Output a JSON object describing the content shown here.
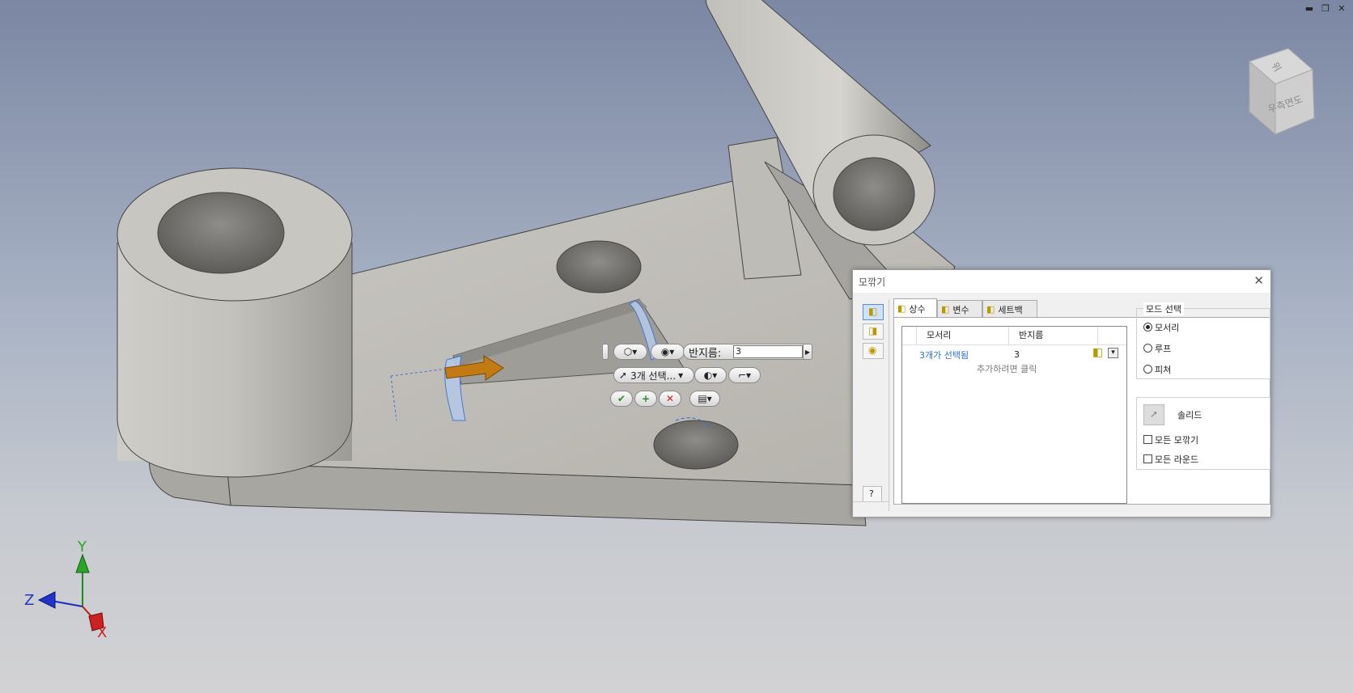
{
  "window_controls": {
    "minimize": "▬",
    "restore": "❐",
    "close": "✕"
  },
  "viewcube": {
    "top_face": "위",
    "right_face": "우측면도"
  },
  "triad": {
    "y": "Y",
    "z": "Z",
    "x": "X"
  },
  "mini_toolbar": {
    "radius_label": "반지름:",
    "radius_value": "3",
    "selection_label": "3개 선택...",
    "ok_icon": "✔",
    "add_icon": "+",
    "cancel_icon": "✕",
    "arrow_right": "▶",
    "dropdown": "▾"
  },
  "dialog": {
    "title": "모깎기",
    "close": "✕",
    "help": "?",
    "tabs": [
      {
        "label": "상수",
        "active": true
      },
      {
        "label": "변수",
        "active": false
      },
      {
        "label": "세트백",
        "active": false
      }
    ],
    "grid": {
      "col_edge": "모서리",
      "col_radius": "반지름",
      "row_edge": "3개가 선택됨",
      "row_radius": "3",
      "add_hint": "추가하려면 클릭",
      "dropdown": "▾"
    },
    "mode_select": {
      "legend": "모드 선택",
      "options": [
        {
          "label": "모서리",
          "selected": true
        },
        {
          "label": "루프",
          "selected": false
        },
        {
          "label": "피쳐",
          "selected": false
        }
      ]
    },
    "solid_label": "솔리드",
    "all_fillets": "모든 모깎기",
    "all_rounds": "모든 라운드"
  },
  "colors": {
    "accent": "#2f72c9",
    "viewport_top": "#7b87a3",
    "viewport_bottom": "#d2d2d4",
    "preview_arrow": "#c27a12"
  }
}
